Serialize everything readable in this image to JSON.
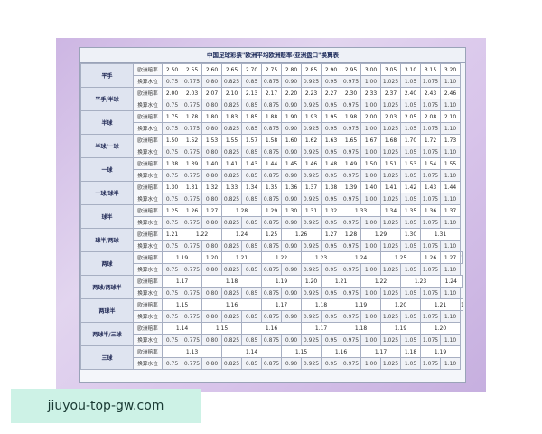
{
  "title": "中国足球彩票\"欧洲平均欧洲赔率-亚洲盘口\"换算表",
  "watermark": "jiuyou-top-gw.com",
  "row_labels": {
    "odds": "欧洲赔率",
    "water": "换算水位"
  },
  "water_values": [
    "0.75",
    "0.775",
    "0.80",
    "0.825",
    "0.85",
    "0.875",
    "0.90",
    "0.925",
    "0.95",
    "0.975",
    "1.00",
    "1.025",
    "1.05",
    "1.075",
    "1.10"
  ],
  "bands": [
    {
      "name": "平手",
      "odds": [
        [
          1,
          "2.50"
        ],
        [
          1,
          "2.55"
        ],
        [
          1,
          "2.60"
        ],
        [
          1,
          "2.65"
        ],
        [
          1,
          "2.70"
        ],
        [
          1,
          "2.75"
        ],
        [
          1,
          "2.80"
        ],
        [
          1,
          "2.85"
        ],
        [
          1,
          "2.90"
        ],
        [
          1,
          "2.95"
        ],
        [
          1,
          "3.00"
        ],
        [
          1,
          "3.05"
        ],
        [
          1,
          "3.10"
        ],
        [
          1,
          "3.15"
        ],
        [
          1,
          "3.20"
        ]
      ]
    },
    {
      "name": "平手/半球",
      "odds": [
        [
          1,
          "2.00"
        ],
        [
          1,
          "2.03"
        ],
        [
          1,
          "2.07"
        ],
        [
          1,
          "2.10"
        ],
        [
          1,
          "2.13"
        ],
        [
          1,
          "2.17"
        ],
        [
          1,
          "2.20"
        ],
        [
          1,
          "2.23"
        ],
        [
          1,
          "2.27"
        ],
        [
          1,
          "2.30"
        ],
        [
          1,
          "2.33"
        ],
        [
          1,
          "2.37"
        ],
        [
          1,
          "2.40"
        ],
        [
          1,
          "2.43"
        ],
        [
          1,
          "2.46"
        ]
      ]
    },
    {
      "name": "半球",
      "odds": [
        [
          1,
          "1.75"
        ],
        [
          1,
          "1.78"
        ],
        [
          1,
          "1.80"
        ],
        [
          1,
          "1.83"
        ],
        [
          1,
          "1.85"
        ],
        [
          1,
          "1.88"
        ],
        [
          1,
          "1.90"
        ],
        [
          1,
          "1.93"
        ],
        [
          1,
          "1.95"
        ],
        [
          1,
          "1.98"
        ],
        [
          1,
          "2.00"
        ],
        [
          1,
          "2.03"
        ],
        [
          1,
          "2.05"
        ],
        [
          1,
          "2.08"
        ],
        [
          1,
          "2.10"
        ]
      ]
    },
    {
      "name": "半球/一球",
      "odds": [
        [
          1,
          "1.50"
        ],
        [
          1,
          "1.52"
        ],
        [
          1,
          "1.53"
        ],
        [
          1,
          "1.55"
        ],
        [
          1,
          "1.57"
        ],
        [
          1,
          "1.58"
        ],
        [
          1,
          "1.60"
        ],
        [
          1,
          "1.62"
        ],
        [
          1,
          "1.63"
        ],
        [
          1,
          "1.65"
        ],
        [
          1,
          "1.67"
        ],
        [
          1,
          "1.68"
        ],
        [
          1,
          "1.70"
        ],
        [
          1,
          "1.72"
        ],
        [
          1,
          "1.73"
        ]
      ]
    },
    {
      "name": "一球",
      "odds": [
        [
          1,
          "1.38"
        ],
        [
          1,
          "1.39"
        ],
        [
          1,
          "1.40"
        ],
        [
          1,
          "1.41"
        ],
        [
          1,
          "1.43"
        ],
        [
          1,
          "1.44"
        ],
        [
          1,
          "1.45"
        ],
        [
          1,
          "1.46"
        ],
        [
          1,
          "1.48"
        ],
        [
          1,
          "1.49"
        ],
        [
          1,
          "1.50"
        ],
        [
          1,
          "1.51"
        ],
        [
          1,
          "1.53"
        ],
        [
          1,
          "1.54"
        ],
        [
          1,
          "1.55"
        ]
      ]
    },
    {
      "name": "一球/球半",
      "odds": [
        [
          1,
          "1.30"
        ],
        [
          1,
          "1.31"
        ],
        [
          1,
          "1.32"
        ],
        [
          1,
          "1.33"
        ],
        [
          1,
          "1.34"
        ],
        [
          1,
          "1.35"
        ],
        [
          1,
          "1.36"
        ],
        [
          1,
          "1.37"
        ],
        [
          1,
          "1.38"
        ],
        [
          1,
          "1.39"
        ],
        [
          1,
          "1.40"
        ],
        [
          1,
          "1.41"
        ],
        [
          1,
          "1.42"
        ],
        [
          1,
          "1.43"
        ],
        [
          1,
          "1.44"
        ]
      ]
    },
    {
      "name": "球半",
      "odds": [
        [
          1,
          "1.25"
        ],
        [
          1,
          "1.26"
        ],
        [
          1,
          "1.27"
        ],
        [
          2,
          "1.28"
        ],
        [
          1,
          "1.29"
        ],
        [
          1,
          "1.30"
        ],
        [
          1,
          "1.31"
        ],
        [
          1,
          "1.32"
        ],
        [
          2,
          "1.33"
        ],
        [
          1,
          "1.34"
        ],
        [
          1,
          "1.35"
        ],
        [
          1,
          "1.36"
        ],
        [
          1,
          "1.37"
        ]
      ]
    },
    {
      "name": "球半/两球",
      "odds": [
        [
          1,
          "1.21"
        ],
        [
          2,
          "1.22"
        ],
        [
          2,
          "1.24"
        ],
        [
          1,
          "1.25"
        ],
        [
          2,
          "1.26"
        ],
        [
          1,
          "1.27"
        ],
        [
          1,
          "1.28"
        ],
        [
          2,
          "1.29"
        ],
        [
          1,
          "1.30"
        ],
        [
          2,
          "1.31"
        ]
      ]
    },
    {
      "name": "两球",
      "odds": [
        [
          2,
          "1.19"
        ],
        [
          1,
          "1.20"
        ],
        [
          2,
          "1.21"
        ],
        [
          2,
          "1.22"
        ],
        [
          2,
          "1.23"
        ],
        [
          2,
          "1.24"
        ],
        [
          2,
          "1.25"
        ],
        [
          1,
          "1.26"
        ],
        [
          1,
          "1.27"
        ],
        [
          1,
          "1.28"
        ]
      ]
    },
    {
      "name": "两球/两球半",
      "odds": [
        [
          2,
          "1.17"
        ],
        [
          3,
          "1.18"
        ],
        [
          2,
          "1.19"
        ],
        [
          1,
          "1.20"
        ],
        [
          2,
          "1.21"
        ],
        [
          2,
          "1.22"
        ],
        [
          2,
          "1.23"
        ],
        [
          2,
          "1.24"
        ]
      ]
    },
    {
      "name": "两球半",
      "odds": [
        [
          2,
          "1.15"
        ],
        [
          3,
          "1.16"
        ],
        [
          2,
          "1.17"
        ],
        [
          2,
          "1.18"
        ],
        [
          2,
          "1.19"
        ],
        [
          2,
          "1.20"
        ],
        [
          2,
          "1.21"
        ],
        [
          2,
          "1.22"
        ]
      ]
    },
    {
      "name": "两球半/三球",
      "odds": [
        [
          2,
          "1.14"
        ],
        [
          2,
          "1.15"
        ],
        [
          3,
          "1.16"
        ],
        [
          2,
          "1.17"
        ],
        [
          2,
          "1.18"
        ],
        [
          2,
          "1.19"
        ],
        [
          2,
          "1.20"
        ]
      ]
    },
    {
      "name": "三球",
      "odds": [
        [
          3,
          "1.13"
        ],
        [
          3,
          "1.14"
        ],
        [
          2,
          "1.15"
        ],
        [
          2,
          "1.16"
        ],
        [
          2,
          "1.17"
        ],
        [
          1,
          "1.18"
        ],
        [
          2,
          "1.19"
        ]
      ]
    }
  ]
}
